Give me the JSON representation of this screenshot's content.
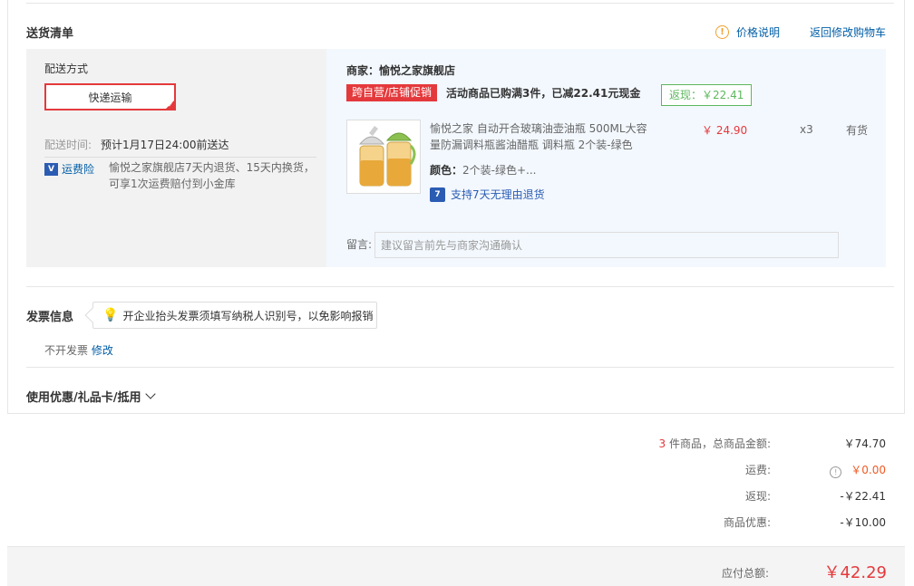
{
  "shipping_section": {
    "title": "送货清单",
    "price_explain": "价格说明",
    "back_to_cart": "返回修改购物车",
    "method_label": "配送方式",
    "method_value": "快递运输",
    "time_label": "配送时间:",
    "time_value": "预计1月17日24:00前送达",
    "insurance_label": "运费险",
    "insurance_badge": "V",
    "insurance_text": "愉悦之家旗舰店7天内退货、15天内换货，可享1次运费赔付到小金库"
  },
  "goods": {
    "seller": "商家：愉悦之家旗舰店",
    "promo_tag": "跨自营/店铺促销",
    "promo_desc": "活动商品已购满3件，已减22.41元现金",
    "rebate": "返现：￥22.41",
    "product": {
      "name": "愉悦之家 自动开合玻璃油壶油瓶 500ML大容量防漏调料瓶酱油醋瓶 调料瓶 2个装-绿色",
      "price": "￥ 24.90",
      "qty": "x3",
      "stock": "有货",
      "color_label": "颜色：",
      "color_value": "2个装-绿色+...",
      "return_policy": "支持7天无理由退货",
      "return_icon": "7"
    },
    "message_label": "留言:",
    "message_placeholder": "建议留言前先与商家沟通确认"
  },
  "invoice": {
    "title": "发票信息",
    "tip": "开企业抬头发票须填写纳税人识别号，以免影响报销",
    "value": "不开发票",
    "modify": "修改"
  },
  "coupon": {
    "title": "使用优惠/礼品卡/抵用"
  },
  "summary": {
    "count": "3",
    "count_label": "件商品，总商品金额:",
    "goods_total": "￥74.70",
    "freight_label": "运费:",
    "freight_value": "￥0.00",
    "rebate_label": "返现:",
    "rebate_value": "-￥22.41",
    "discount_label": "商品优惠:",
    "discount_value": "-￥10.00",
    "total_label": "应付总额:",
    "total_value": "￥42.29"
  },
  "colors": {
    "accent_red": "#e4393c",
    "link_blue": "#005ea7",
    "rebate_green": "#5cb85c"
  }
}
